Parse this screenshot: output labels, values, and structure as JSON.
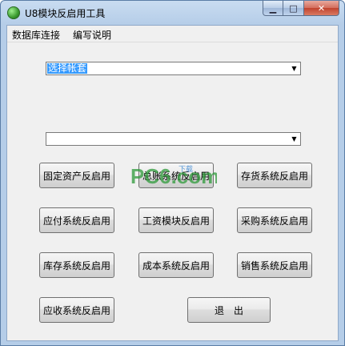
{
  "window": {
    "title": "U8模块反启用工具"
  },
  "menu": {
    "items": [
      "数据库连接",
      "编写说明"
    ]
  },
  "combo_account": {
    "value": "选择帐套"
  },
  "combo_second": {
    "value": ""
  },
  "buttons": {
    "fixed_assets": "固定资产反启用",
    "general_ledger": "总账系统反启用",
    "inventory_goods": "存货系统反启用",
    "payable": "应付系统反启用",
    "payroll": "工资模块反启用",
    "purchase": "采购系统反启用",
    "stock": "库存系统反启用",
    "cost": "成本系统反启用",
    "sales": "销售系统反启用",
    "receivable": "应收系统反启用",
    "exit": "退　出"
  },
  "watermark": {
    "text": "PC6.com",
    "sub": "下载"
  }
}
